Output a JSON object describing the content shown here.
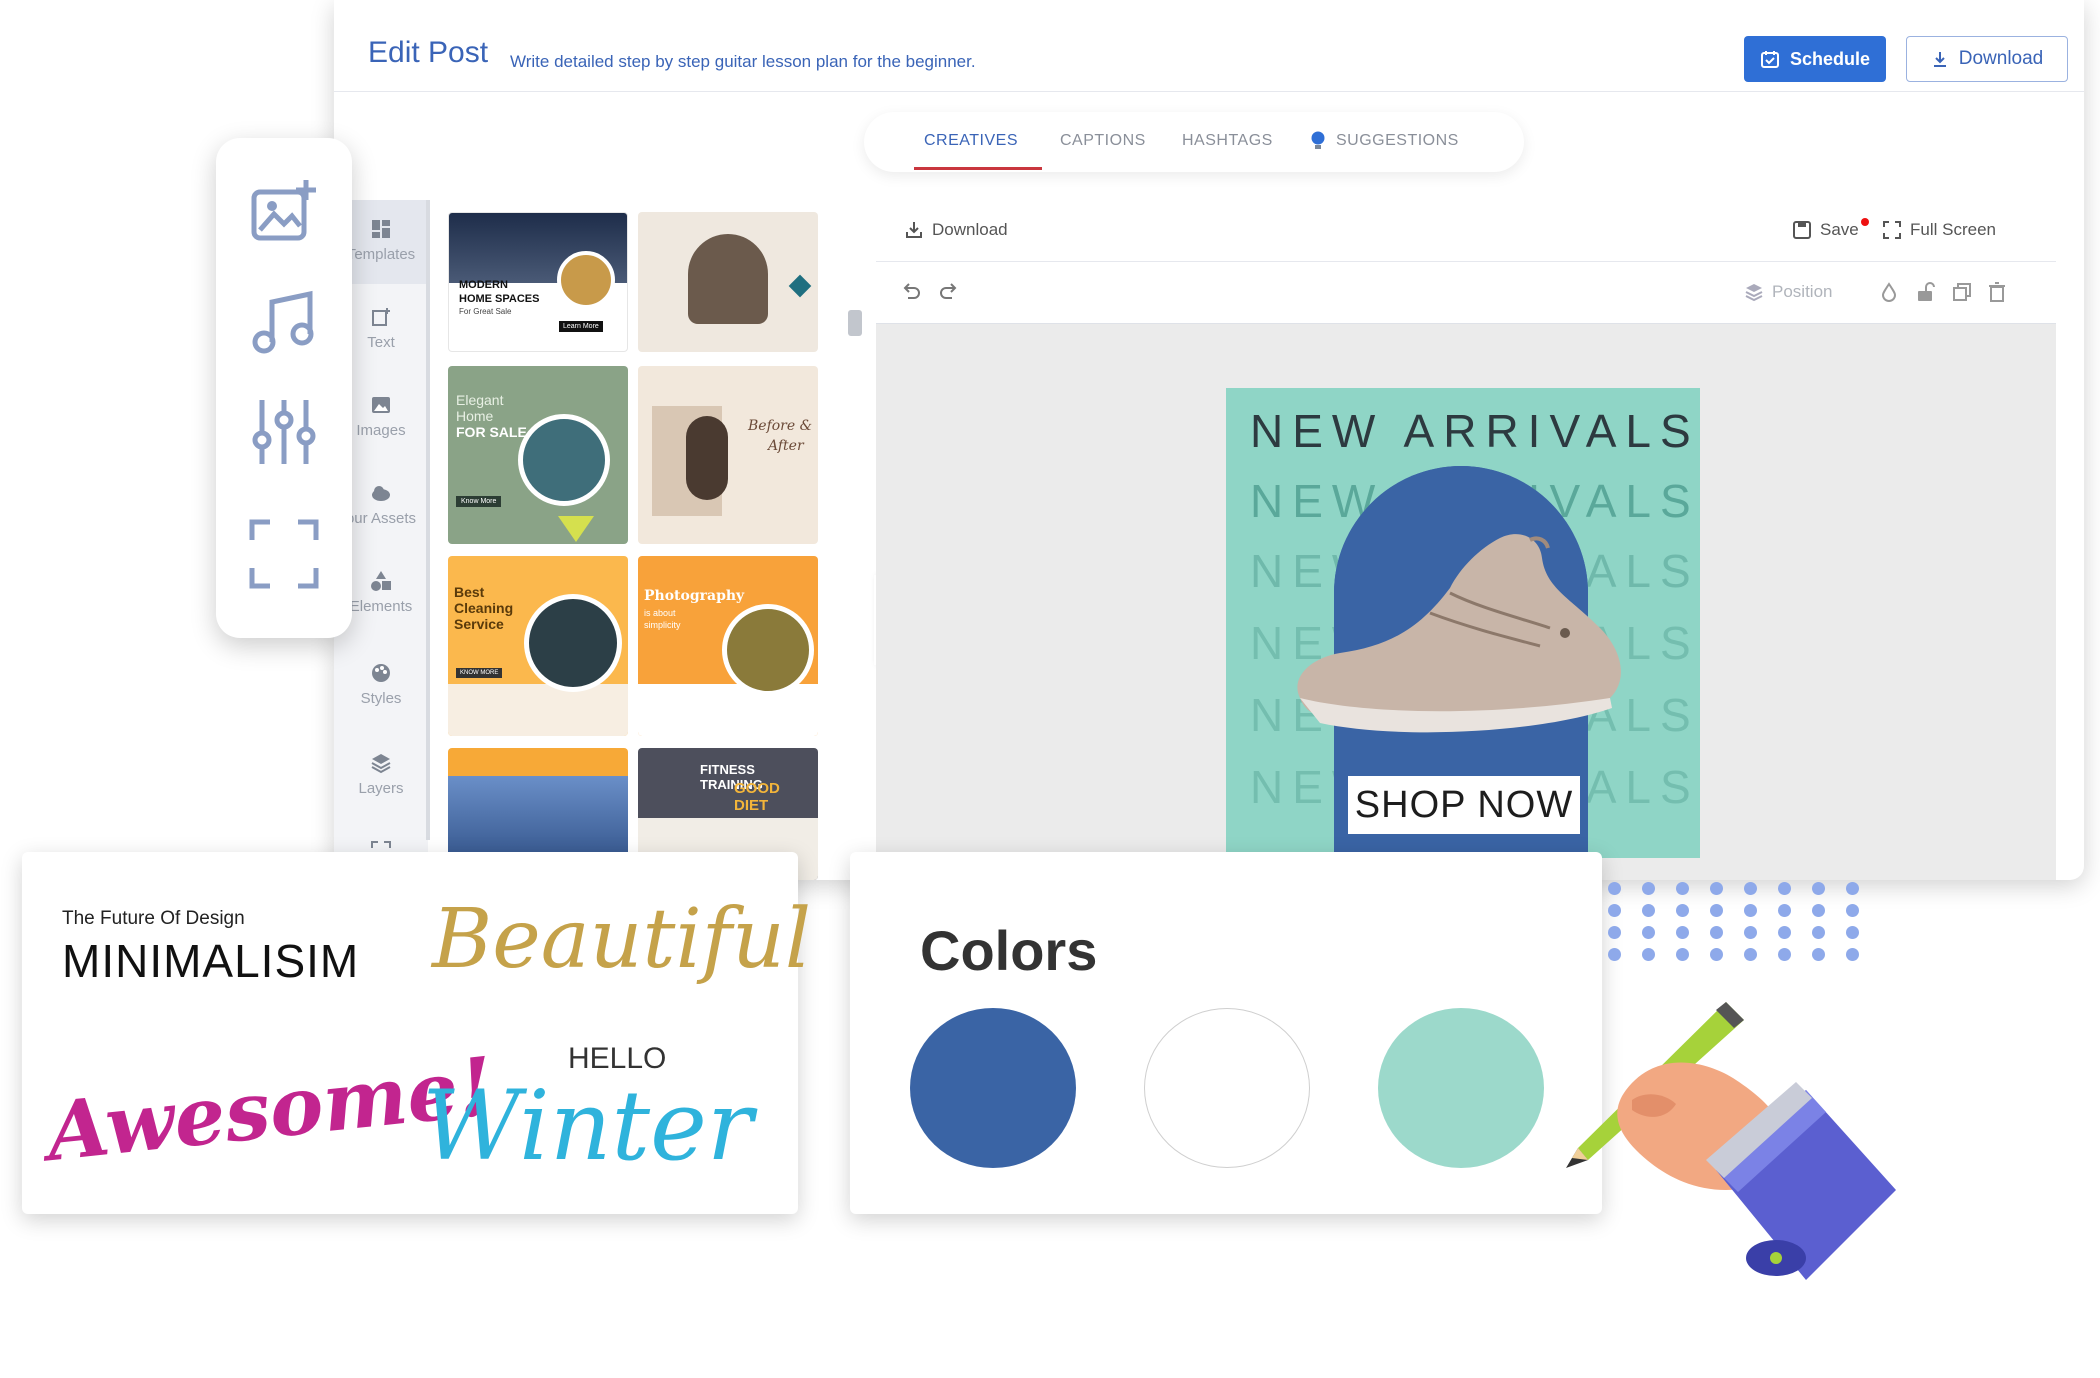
{
  "header": {
    "title": "Edit Post",
    "subtitle": "Write detailed step by step guitar lesson plan for the beginner.",
    "schedule_label": "Schedule",
    "download_label": "Download"
  },
  "tabs": [
    {
      "label": "CREATIVES",
      "active": true
    },
    {
      "label": "CAPTIONS",
      "active": false
    },
    {
      "label": "HASHTAGS",
      "active": false
    },
    {
      "label": "SUGGESTIONS",
      "active": false
    }
  ],
  "toolstrip": [
    {
      "label": "Templates",
      "icon": "templates-icon"
    },
    {
      "label": "Text",
      "icon": "text-icon"
    },
    {
      "label": "Images",
      "icon": "image-icon"
    },
    {
      "label": "our Assets",
      "icon": "cloud-icon"
    },
    {
      "label": "Elements",
      "icon": "shapes-icon"
    },
    {
      "label": "Styles",
      "icon": "palette-icon"
    },
    {
      "label": "Layers",
      "icon": "layers-icon"
    }
  ],
  "templates": [
    {
      "lines": [
        "MODERN",
        "HOME SPACES",
        "For Great Sale",
        "Learn More"
      ],
      "bg": "#ffffff"
    },
    {
      "lines": [],
      "bg": "#efe8df"
    },
    {
      "lines": [
        "Elegant",
        "Home",
        "FOR SALE",
        "Know More"
      ],
      "bg": "#8aa387"
    },
    {
      "lines": [
        "Before &",
        "After"
      ],
      "bg": "#f2e8dc"
    },
    {
      "lines": [
        "Best",
        "Cleaning",
        "Service",
        "KNOW MORE"
      ],
      "bg": "#fbb84d"
    },
    {
      "lines": [
        "Photography",
        "is about",
        "simplicity"
      ],
      "bg": "#f8a23a"
    },
    {
      "lines": [],
      "bg": "#f7a937"
    },
    {
      "lines": [
        "FITNESS TRAINING",
        "GOOD DIET"
      ],
      "bg": "#4d4f5c"
    }
  ],
  "canvas_toolbar": {
    "download_label": "Download",
    "save_label": "Save",
    "fullscreen_label": "Full Screen",
    "position_label": "Position"
  },
  "creative": {
    "headline": "NEW ARRIVALS",
    "cta": "SHOP NOW",
    "bg_color": "#8fd5c6",
    "arch_color": "#3a64a5"
  },
  "fonts_card": {
    "future_label": "The Future Of Design",
    "minimalism": "MINIMALISIM",
    "beautiful": "Beautiful",
    "hello": "HELLO",
    "awesome": "Awesome!",
    "winter": "Winter"
  },
  "colors_card": {
    "title": "Colors",
    "swatches": [
      "#3a64a5",
      "#ffffff",
      "#9cd9cb"
    ]
  },
  "accent_color": "#2f6fd6"
}
